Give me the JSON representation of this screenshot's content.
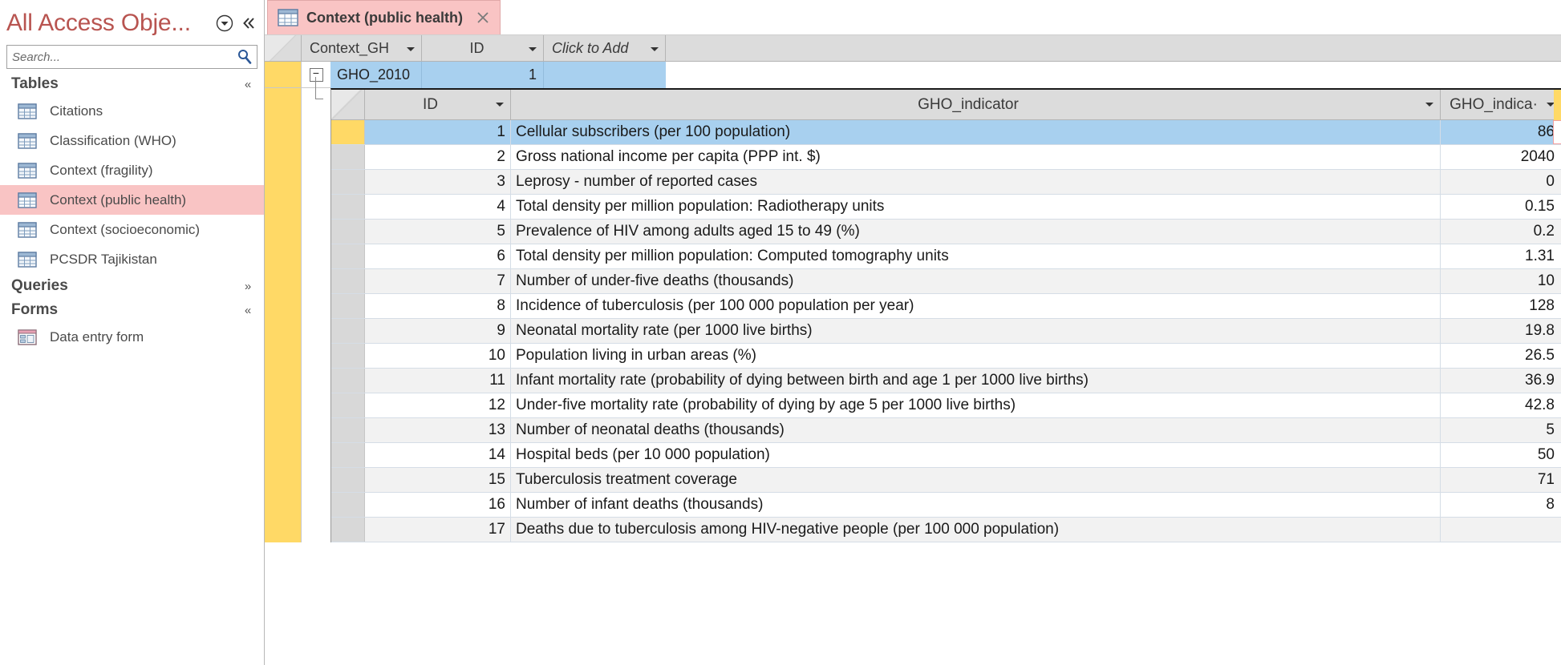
{
  "navpane": {
    "title": "All Access Obje...",
    "dropdown_icon": "chevron-down-circle-icon",
    "collapse_icon": "double-chevron-left-icon",
    "search": {
      "placeholder": "Search...",
      "value": "",
      "icon": "search-icon"
    },
    "groups": [
      {
        "label": "Tables",
        "chevron": "«",
        "items": [
          {
            "label": "Citations",
            "icon": "table-icon",
            "selected": false
          },
          {
            "label": "Classification (WHO)",
            "icon": "table-icon",
            "selected": false
          },
          {
            "label": "Context (fragility)",
            "icon": "table-icon",
            "selected": false
          },
          {
            "label": "Context (public health)",
            "icon": "table-icon",
            "selected": true
          },
          {
            "label": "Context (socioeconomic)",
            "icon": "table-icon",
            "selected": false
          },
          {
            "label": "PCSDR Tajikistan",
            "icon": "table-icon",
            "selected": false
          }
        ]
      },
      {
        "label": "Queries",
        "chevron": "»",
        "items": []
      },
      {
        "label": "Forms",
        "chevron": "«",
        "items": [
          {
            "label": "Data entry form",
            "icon": "form-icon",
            "selected": false
          }
        ]
      }
    ]
  },
  "tabs": [
    {
      "label": "Context (public health)",
      "icon": "table-icon",
      "close_icon": "close-icon",
      "active": true
    }
  ],
  "outer_datasheet": {
    "columns": [
      {
        "label": "Context_GH",
        "has_dropdown": true
      },
      {
        "label": "ID",
        "has_dropdown": true
      },
      {
        "label": "Click to Add",
        "has_dropdown": true,
        "italic": true
      }
    ],
    "rows": [
      {
        "expander": "−",
        "Context_GH": "GHO_2010",
        "ID": "1",
        "selected": true
      }
    ]
  },
  "sub_datasheet": {
    "columns": [
      {
        "label": "ID",
        "has_dropdown": true
      },
      {
        "label": "GHO_indicator",
        "has_dropdown": true
      },
      {
        "label": "GHO_indica·",
        "has_dropdown": true
      }
    ],
    "rows": [
      {
        "id": "1",
        "indicator": "Cellular subscribers (per 100 population)",
        "value": "86",
        "selected": true
      },
      {
        "id": "2",
        "indicator": "Gross national income per capita (PPP int. $)",
        "value": "2040",
        "selected": false
      },
      {
        "id": "3",
        "indicator": "Leprosy - number of reported cases",
        "value": "0",
        "selected": false
      },
      {
        "id": "4",
        "indicator": "Total density per million population: Radiotherapy units",
        "value": "0.15",
        "selected": false
      },
      {
        "id": "5",
        "indicator": "Prevalence of HIV among adults aged 15 to 49 (%)",
        "value": "0.2",
        "selected": false
      },
      {
        "id": "6",
        "indicator": "Total density per million population: Computed tomography units",
        "value": "1.31",
        "selected": false
      },
      {
        "id": "7",
        "indicator": "Number of under-five deaths (thousands)",
        "value": "10",
        "selected": false
      },
      {
        "id": "8",
        "indicator": "Incidence of tuberculosis (per 100 000 population per year)",
        "value": "128",
        "selected": false
      },
      {
        "id": "9",
        "indicator": "Neonatal mortality rate (per 1000 live births)",
        "value": "19.8",
        "selected": false
      },
      {
        "id": "10",
        "indicator": "Population living in urban areas (%)",
        "value": "26.5",
        "selected": false
      },
      {
        "id": "11",
        "indicator": "Infant mortality rate (probability of dying between birth and age 1 per 1000 live births)",
        "value": "36.9",
        "selected": false
      },
      {
        "id": "12",
        "indicator": "Under-five mortality rate (probability of dying by age 5 per 1000 live births)",
        "value": "42.8",
        "selected": false
      },
      {
        "id": "13",
        "indicator": "Number of neonatal deaths (thousands)",
        "value": "5",
        "selected": false
      },
      {
        "id": "14",
        "indicator": "Hospital beds (per 10 000 population)",
        "value": "50",
        "selected": false
      },
      {
        "id": "15",
        "indicator": "Tuberculosis treatment coverage",
        "value": "71",
        "selected": false
      },
      {
        "id": "16",
        "indicator": "Number of infant deaths (thousands)",
        "value": "8",
        "selected": false
      },
      {
        "id": "17",
        "indicator": "Deaths due to tuberculosis among HIV-negative people (per 100 000 population)",
        "value": "",
        "selected": false
      }
    ]
  },
  "colors": {
    "accent_title": "#b85450",
    "selected_item": "#f9c4c4",
    "row_selected": "#a8d0ef",
    "row_marker": "#ffd966",
    "header_gray": "#dcdcdc"
  }
}
